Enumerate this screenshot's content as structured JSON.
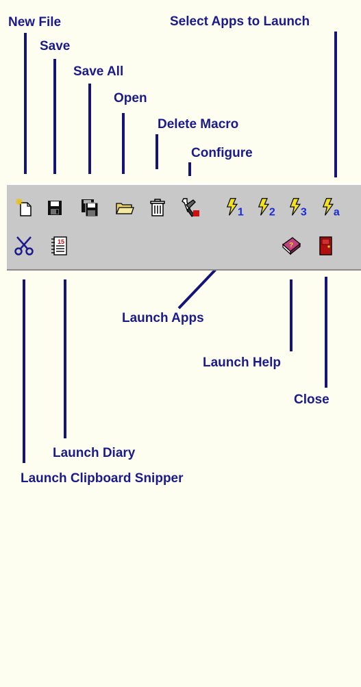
{
  "labels": {
    "new_file": "New File",
    "save": "Save",
    "save_all": "Save All",
    "open": "Open",
    "delete_macro": "Delete Macro",
    "configure": "Configure",
    "select_apps": "Select Apps to Launch",
    "launch_apps": "Launch Apps",
    "launch_help": "Launch Help",
    "close": "Close",
    "launch_diary": "Launch Diary",
    "launch_clipboard": "Launch Clipboard Snipper"
  },
  "toolbar": {
    "launch_buttons": [
      "1",
      "2",
      "3",
      "a"
    ],
    "diary_page": "15"
  },
  "colors": {
    "label": "#1a1a8c",
    "leader_line": "#141478",
    "toolbar_bg": "#c8c8c8",
    "bolt": "#f0e020",
    "background": "#fdfdf0"
  },
  "icons": {
    "new_file": "new-file-icon",
    "save": "floppy-disk-icon",
    "save_all": "multiple-floppy-icon",
    "open": "open-folder-icon",
    "delete_macro": "trash-can-icon",
    "configure": "tools-icon",
    "launch_apps": "lightning-bolt-icon",
    "clipboard": "scissors-icon",
    "diary": "calendar-icon",
    "help": "help-book-icon",
    "close": "exit-door-icon"
  }
}
